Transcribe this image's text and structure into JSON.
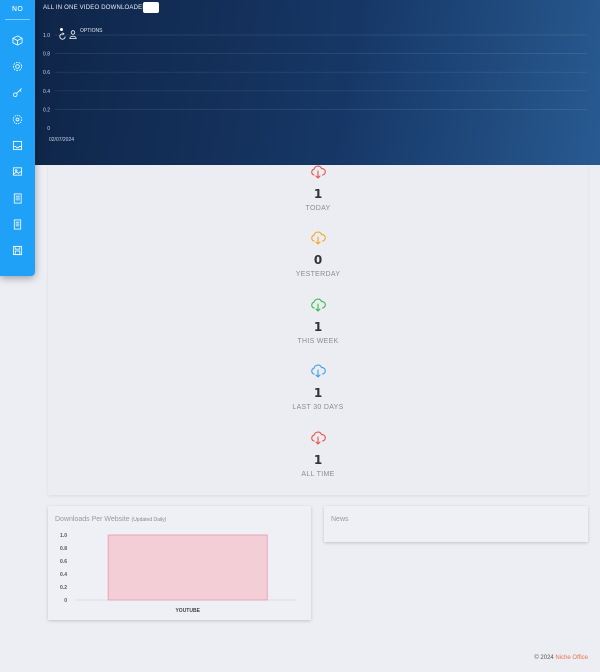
{
  "sidebar": {
    "brand": "NO",
    "items": [
      {
        "icon": "box-icon"
      },
      {
        "icon": "gear-icon"
      },
      {
        "icon": "key-icon"
      },
      {
        "icon": "settings-icon"
      },
      {
        "icon": "inbox-icon"
      },
      {
        "icon": "image-icon"
      },
      {
        "icon": "book-icon"
      },
      {
        "icon": "document-icon"
      },
      {
        "icon": "save-icon"
      }
    ]
  },
  "header": {
    "title": "ALL IN ONE VIDEO DOWNLOADER",
    "options_label": "OPTIONS"
  },
  "header_chart": {
    "type": "line",
    "yticks": [
      "1.0",
      "0.8",
      "0.6",
      "0.4",
      "0.2",
      "0"
    ],
    "x": [
      "02/07/2024"
    ],
    "ylim": [
      0,
      1
    ],
    "grid": true
  },
  "stats": [
    {
      "value": "1",
      "label": "TODAY",
      "color": "#e8534b",
      "icon": "cloud-download-icon"
    },
    {
      "value": "0",
      "label": "YESTERDAY",
      "color": "#f5a623",
      "icon": "cloud-download-icon"
    },
    {
      "value": "1",
      "label": "THIS WEEK",
      "color": "#3cb84a",
      "icon": "cloud-download-icon"
    },
    {
      "value": "1",
      "label": "LAST 30 DAYS",
      "color": "#3aa0e6",
      "icon": "cloud-download-icon"
    },
    {
      "value": "1",
      "label": "ALL TIME",
      "color": "#e8534b",
      "icon": "cloud-download-icon"
    }
  ],
  "downloads_card": {
    "title": "Downloads Per Website",
    "subtitle": "(Updated Daily)"
  },
  "news_card": {
    "title": "News"
  },
  "chart_data": {
    "type": "bar",
    "categories": [
      "YOUTUBE"
    ],
    "values": [
      1
    ],
    "yticks": [
      "1.0",
      "0.8",
      "0.6",
      "0.4",
      "0.2",
      "0"
    ],
    "ylim": [
      0,
      1
    ],
    "bar_color": "#f3ced7",
    "bar_border": "#e79aac"
  },
  "footer": {
    "copyright": "© 2024",
    "link": "Niche Office"
  }
}
